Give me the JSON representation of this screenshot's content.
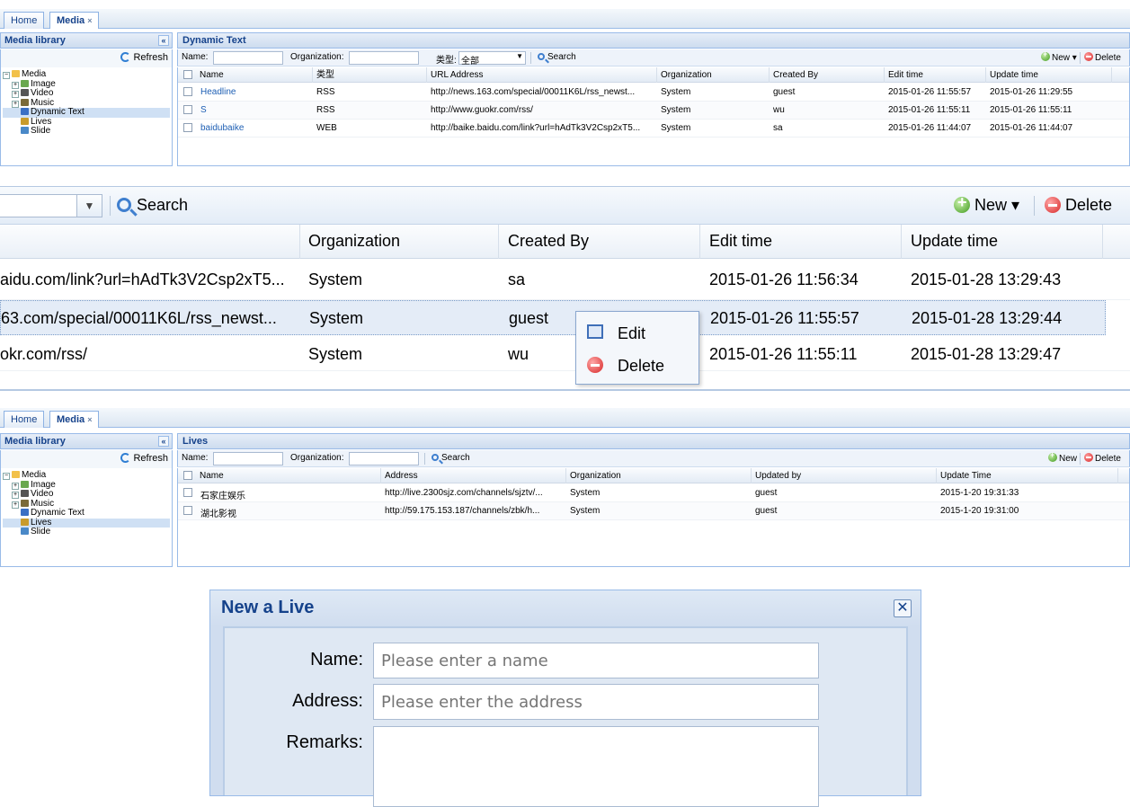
{
  "tabs": {
    "home": "Home",
    "media": "Media",
    "close_glyph": "×"
  },
  "sidebar": {
    "title": "Media library",
    "collapse_glyph": "«",
    "refresh": "Refresh",
    "root": "Media",
    "items": [
      "Image",
      "Video",
      "Music",
      "Dynamic Text",
      "Lives",
      "Slide"
    ]
  },
  "panel1": {
    "title": "Dynamic Text",
    "toolbar": {
      "name_label": "Name:",
      "org_label": "Organization:",
      "type_label": "类型:",
      "type_value": "全部",
      "search": "Search",
      "new": "New",
      "delete": "Delete"
    },
    "columns": [
      "Name",
      "类型",
      "URL Address",
      "Organization",
      "Created By",
      "Edit time",
      "Update time"
    ],
    "rows": [
      [
        "Headline",
        "RSS",
        "http://news.163.com/special/00011K6L/rss_newst...",
        "System",
        "guest",
        "2015-01-26 11:55:57",
        "2015-01-26 11:29:55"
      ],
      [
        "S",
        "RSS",
        "http://www.guokr.com/rss/",
        "System",
        "wu",
        "2015-01-26 11:55:11",
        "2015-01-26 11:55:11"
      ],
      [
        "baidubaike",
        "WEB",
        "http://baike.baidu.com/link?url=hAdTk3V2Csp2xT5...",
        "System",
        "sa",
        "2015-01-26 11:44:07",
        "2015-01-26 11:44:07"
      ]
    ]
  },
  "zoom": {
    "search": "Search",
    "new": "New",
    "delete": "Delete",
    "columns": [
      "Organization",
      "Created By",
      "Edit time",
      "Update time"
    ],
    "rows": [
      [
        "aidu.com/link?url=hAdTk3V2Csp2xT5...",
        "System",
        "sa",
        "2015-01-26 11:56:34",
        "2015-01-28 13:29:43"
      ],
      [
        "63.com/special/00011K6L/rss_newst...",
        "System",
        "guest",
        "2015-01-26 11:55:57",
        "2015-01-28 13:29:44"
      ],
      [
        "okr.com/rss/",
        "System",
        "wu",
        "2015-01-26 11:55:11",
        "2015-01-28 13:29:47"
      ]
    ],
    "context_menu": {
      "edit": "Edit",
      "delete": "Delete"
    }
  },
  "panel2": {
    "title": "Lives",
    "toolbar": {
      "name_label": "Name:",
      "org_label": "Organization:",
      "search": "Search",
      "new": "New",
      "delete": "Delete"
    },
    "columns": [
      "Name",
      "Address",
      "Organization",
      "Updated by",
      "Update Time"
    ],
    "rows": [
      [
        "石家庄娱乐",
        "http://live.2300sjz.com/channels/sjztv/...",
        "System",
        "guest",
        "2015-1-20 19:31:33"
      ],
      [
        "湖北影视",
        "http://59.175.153.187/channels/zbk/h...",
        "System",
        "guest",
        "2015-1-20 19:31:00"
      ]
    ]
  },
  "dialog": {
    "title": "New a Live",
    "close_glyph": "✕",
    "name_label": "Name:",
    "name_placeholder": "Please enter a name",
    "address_label": "Address:",
    "address_placeholder": "Please enter the address",
    "remarks_label": "Remarks:"
  },
  "colors": {
    "accent": "#15428b",
    "border": "#99bbe8",
    "selection": "#cfe0f4"
  }
}
